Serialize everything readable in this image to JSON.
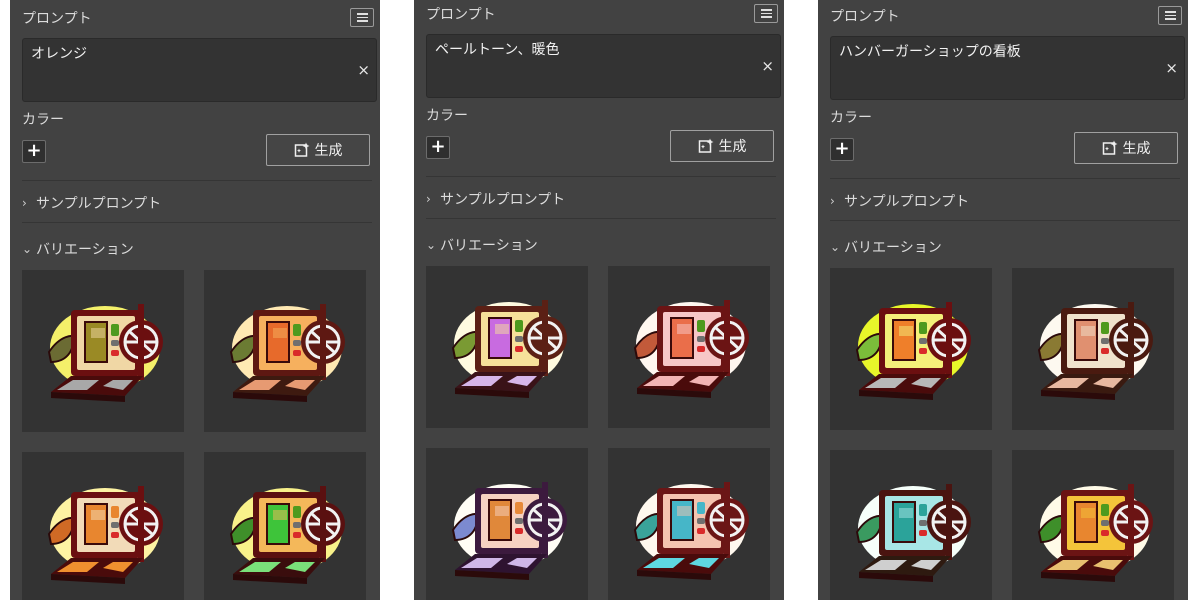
{
  "labels": {
    "prompt": "プロンプト",
    "color": "カラー",
    "generate": "生成",
    "sample_prompts": "サンプルプロンプト",
    "variations": "バリエーション",
    "clear": "×",
    "add_color": "+"
  },
  "icons": {
    "menu": "hamburger-menu-icon",
    "clear": "close-icon",
    "add": "plus-icon",
    "generate": "sparkle-generate-icon",
    "collapsed": "chevron-right-icon",
    "expanded": "chevron-down-icon"
  },
  "panels": [
    {
      "prompt_text": "オレンジ",
      "variations": [
        {
          "bg": "#f4f06a",
          "screen": "#f0d7a5",
          "bezel": "#6b0f10",
          "blocks": "#9a8a25",
          "bar1": "#4e9a1e",
          "bar2": "#6f6f6f",
          "dot": "#d92b2b",
          "leaf": "#6b6b33",
          "base": "#4a0b0b",
          "trim": "#a8a8a8"
        },
        {
          "bg": "#ffe9b3",
          "screen": "#f6b05e",
          "bezel": "#5e1812",
          "blocks": "#e76a2b",
          "bar1": "#4e9a1e",
          "bar2": "#6f6f6f",
          "dot": "#d92b2b",
          "leaf": "#6b7b33",
          "base": "#3e1a10",
          "trim": "#e79a72"
        },
        {
          "bg": "#fdf3a3",
          "screen": "#f2dbb8",
          "bezel": "#6b0f10",
          "blocks": "#e8862f",
          "bar1": "#e8862f",
          "bar2": "#6f6f6f",
          "dot": "#d92b2b",
          "leaf": "#d06a25",
          "base": "#4a0b0b",
          "trim": "#f0902f"
        },
        {
          "bg": "#f8f18a",
          "screen": "#f4b85a",
          "bezel": "#5a1010",
          "blocks": "#3ec43a",
          "bar1": "#4e9a1e",
          "bar2": "#6f6f6f",
          "dot": "#d92b2b",
          "leaf": "#3f8f2a",
          "base": "#3a0d0d",
          "trim": "#7ae07a"
        }
      ]
    },
    {
      "prompt_text": "ペールトーン、暖色",
      "variations": [
        {
          "bg": "#fffbe0",
          "screen": "#f6e19a",
          "bezel": "#5b2015",
          "blocks": "#c86be0",
          "bar1": "#4e9a1e",
          "bar2": "#6f6f6f",
          "dot": "#d92b2b",
          "leaf": "#7a9a33",
          "base": "#3a1218",
          "trim": "#d6b6ea"
        },
        {
          "bg": "#fff7f0",
          "screen": "#f7c7c7",
          "bezel": "#6b1414",
          "blocks": "#ea6e4a",
          "bar1": "#4e9a1e",
          "bar2": "#6f6f6f",
          "dot": "#d92b2b",
          "leaf": "#c25a3a",
          "base": "#4a0b0b",
          "trim": "#f2b4b4"
        },
        {
          "bg": "#fffdf5",
          "screen": "#f6d2c2",
          "bezel": "#3c1a3e",
          "blocks": "#e0883a",
          "bar1": "#e88a3a",
          "bar2": "#6f6f6f",
          "dot": "#d92b2b",
          "leaf": "#7c8ad0",
          "base": "#2e1330",
          "trim": "#cfb7e8"
        },
        {
          "bg": "#fff8ee",
          "screen": "#f4c4b0",
          "bezel": "#6b1616",
          "blocks": "#46b6c8",
          "bar1": "#46b6c8",
          "bar2": "#6f6f6f",
          "dot": "#d92b2b",
          "leaf": "#3aa39a",
          "base": "#4a0b0b",
          "trim": "#5ed7e0"
        }
      ]
    },
    {
      "prompt_text": "ハンバーガーショップの看板",
      "variations": [
        {
          "bg": "#e8f62a",
          "screen": "#f4f07a",
          "bezel": "#6b0f10",
          "blocks": "#ef7f2a",
          "bar1": "#4e9a1e",
          "bar2": "#6f6f6f",
          "dot": "#d92b2b",
          "leaf": "#7bbd3a",
          "base": "#4a0b0b",
          "trim": "#b8b8b8"
        },
        {
          "bg": "#fdf9f0",
          "screen": "#f0e2cc",
          "bezel": "#4a1a10",
          "blocks": "#e09070",
          "bar1": "#4e9a1e",
          "bar2": "#6f6f6f",
          "dot": "#d92b2b",
          "leaf": "#8a7a33",
          "base": "#3a1a10",
          "trim": "#e8b8a0"
        },
        {
          "bg": "#f6fffa",
          "screen": "#a8e6e6",
          "bezel": "#4a1410",
          "blocks": "#2ba39a",
          "bar1": "#2ba39a",
          "bar2": "#6f6f6f",
          "dot": "#d92b2b",
          "leaf": "#3a9a60",
          "base": "#2e1a10",
          "trim": "#cfcfcf"
        },
        {
          "bg": "#fffbe8",
          "screen": "#f4c43a",
          "bezel": "#6b1414",
          "blocks": "#e8862f",
          "bar1": "#4e9a1e",
          "bar2": "#6f6f6f",
          "dot": "#d92b2b",
          "leaf": "#3e8f2a",
          "base": "#4a0b0b",
          "trim": "#e8c070"
        }
      ]
    }
  ]
}
